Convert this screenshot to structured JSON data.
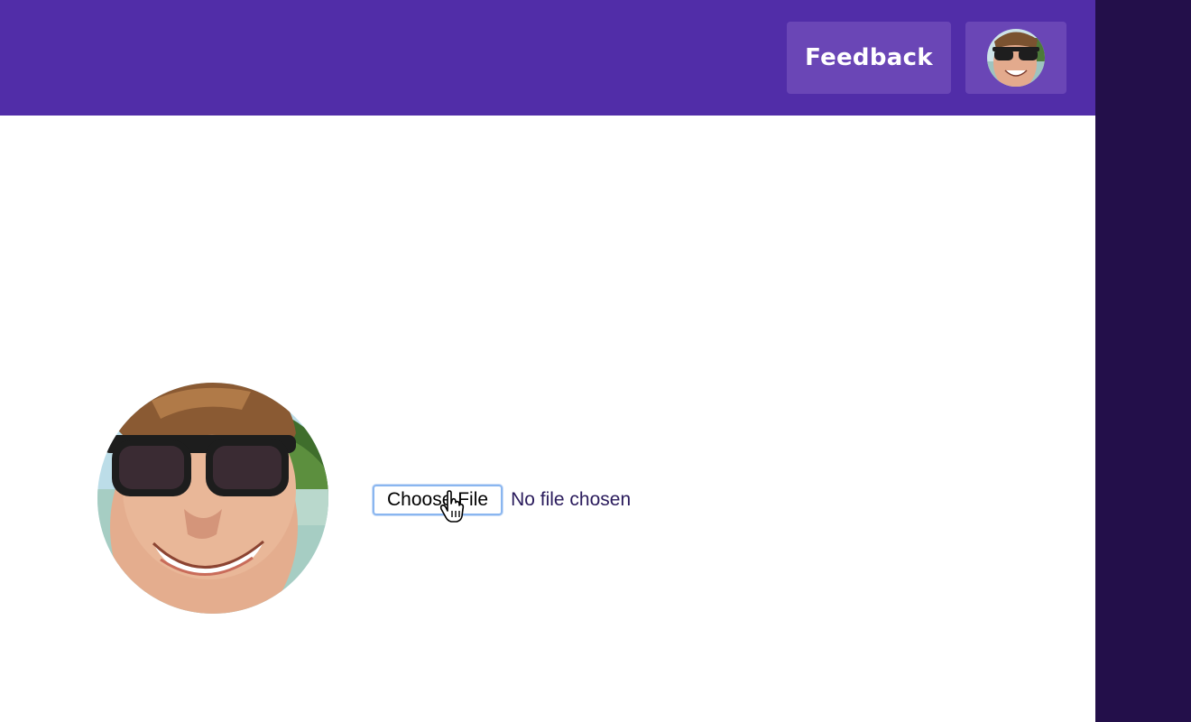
{
  "header": {
    "feedback_label": "Feedback",
    "background_color": "#512da8",
    "button_color": "#6a46b6",
    "account_icon": "user-avatar-photo"
  },
  "profile": {
    "photo_icon": "profile-photo",
    "file_input": {
      "button_label": "Choose File",
      "status_text": "No file chosen"
    }
  },
  "cursor": {
    "icon": "pointer-hand-cursor"
  },
  "side_panel_color": "#230f4a"
}
